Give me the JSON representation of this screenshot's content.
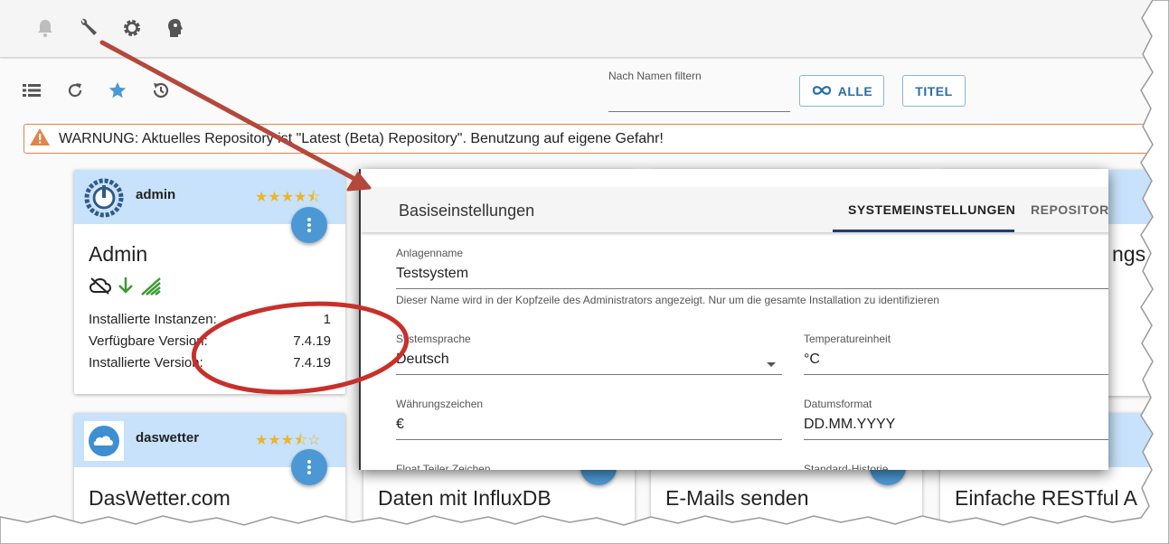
{
  "toolbar": {
    "icons": [
      "bell-icon",
      "wrench-icon",
      "gear-icon",
      "expert-mode-icon"
    ]
  },
  "controls": {
    "icons": [
      "list-view-icon",
      "refresh-icon",
      "star-icon",
      "history-icon"
    ],
    "filter_label": "Nach Namen filtern",
    "filter_value": "",
    "btn_all": "ALLE",
    "btn_title": "TITEL"
  },
  "warning": {
    "text": "WARNUNG: Aktuelles Repository ist \"Latest (Beta) Repository\". Benutzung auf eigene Gefahr!"
  },
  "cards": {
    "admin": {
      "name": "admin",
      "title": "Admin",
      "stars": "★★★★⯪",
      "rows": [
        {
          "label": "Installierte Instanzen:",
          "value": "1"
        },
        {
          "label": "Verfügbare Version:",
          "value": "7.4.19"
        },
        {
          "label": "Installierte Version:",
          "value": "7.4.19"
        }
      ]
    },
    "daswetter": {
      "name": "daswetter",
      "title": "DasWetter.com",
      "stars": "★★★⯪☆"
    },
    "bottom_titles": [
      "Daten mit InfluxDB",
      "E-Mails senden",
      "Einfache RESTful A"
    ],
    "partial_right_title": "ngs"
  },
  "dialog": {
    "title": "Basiseinstellungen",
    "tabs": [
      "SYSTEMEINSTELLUNGEN",
      "REPOSITORIE"
    ],
    "fields": {
      "site_name_label": "Anlagenname",
      "site_name_value": "Testsystem",
      "site_name_help": "Dieser Name wird in der Kopfzeile des Administrators angezeigt. Nur um die gesamte Installation zu identifizieren",
      "language_label": "Systemsprache",
      "language_value": "Deutsch",
      "temp_label": "Temperatureinheit",
      "temp_value": "°C",
      "currency_label": "Währungszeichen",
      "currency_value": "€",
      "date_label": "Datumsformat",
      "date_value": "DD.MM.YYYY",
      "float_label": "Float Teiler Zeichen",
      "history_label": "Standard-Historie"
    }
  },
  "colors": {
    "accent": "#4c98d4",
    "card_header": "#c7e2fa",
    "star": "#f0b323",
    "warning_border": "#e0854a",
    "annotation_red": "#c8302a",
    "tab_active": "#1f3d7a"
  }
}
